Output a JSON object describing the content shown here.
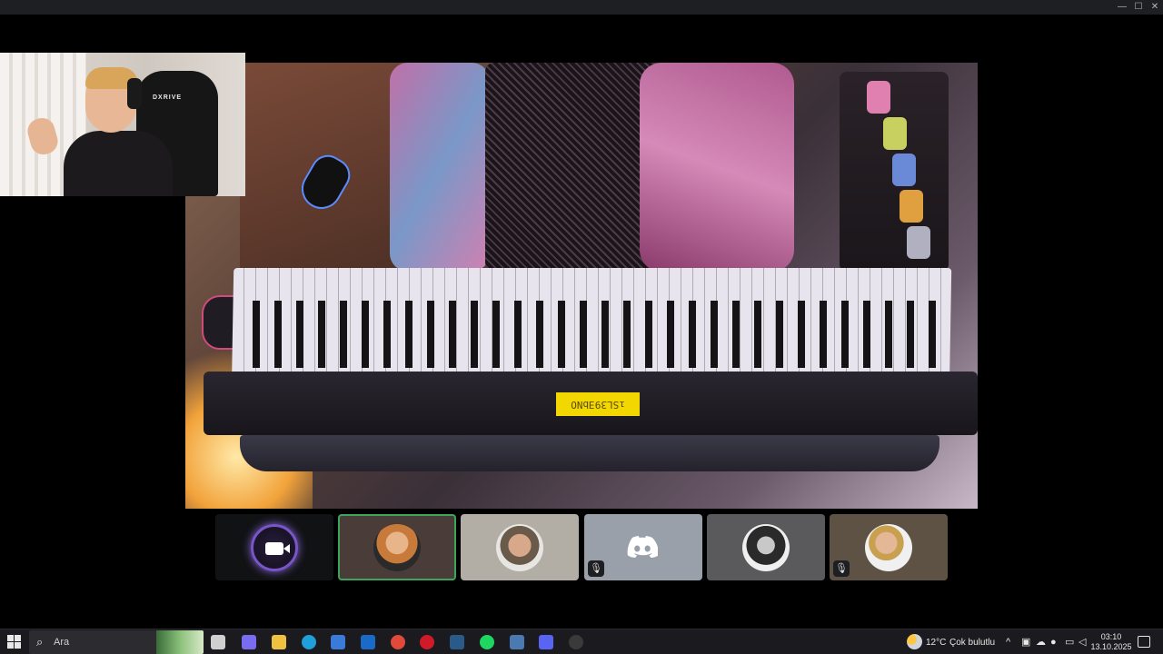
{
  "window": {
    "minimize_glyph": "—",
    "maximize_glyph": "☐",
    "close_glyph": "✕"
  },
  "stream": {
    "piano_display_text": "ıSL39ƎbNO"
  },
  "webcam": {
    "chair_brand": "DXRIVE"
  },
  "participants": [
    {
      "name": "self-camera",
      "muted": false,
      "speaking": false
    },
    {
      "name": "participant-1",
      "muted": false,
      "speaking": true
    },
    {
      "name": "participant-2",
      "muted": false,
      "speaking": false
    },
    {
      "name": "participant-3",
      "muted": true,
      "speaking": false
    },
    {
      "name": "participant-4",
      "muted": false,
      "speaking": false
    },
    {
      "name": "participant-5",
      "muted": true,
      "speaking": false
    }
  ],
  "mute_glyph": "🎙",
  "taskbar": {
    "search_placeholder": "Ara",
    "search_glyph": "⌕",
    "weather_temp": "12°C",
    "weather_desc": "Çok bulutlu",
    "tray_chevron": "^",
    "clock_time": "03:10",
    "clock_date": "13.10.2025",
    "apps": [
      {
        "name": "task-view",
        "color": "#d0d0d0"
      },
      {
        "name": "copilot",
        "color": "#7a6cf0"
      },
      {
        "name": "file-explorer",
        "color": "#f0c040"
      },
      {
        "name": "edge",
        "color": "#1fa0d8"
      },
      {
        "name": "microsoft-store",
        "color": "#3a7ad8"
      },
      {
        "name": "outlook",
        "color": "#1a6ac8"
      },
      {
        "name": "chrome",
        "color": "#e04a3a"
      },
      {
        "name": "opera",
        "color": "#d01a2a"
      },
      {
        "name": "steam",
        "color": "#2a5a8a"
      },
      {
        "name": "spotify",
        "color": "#1ed760"
      },
      {
        "name": "app-launcher",
        "color": "#4a7ab0"
      },
      {
        "name": "discord",
        "color": "#5865f2"
      },
      {
        "name": "obs",
        "color": "#3a3a3a"
      }
    ]
  },
  "colors": {
    "speaking_border": "#3ba55c",
    "discord_blurple": "#5865f2"
  }
}
